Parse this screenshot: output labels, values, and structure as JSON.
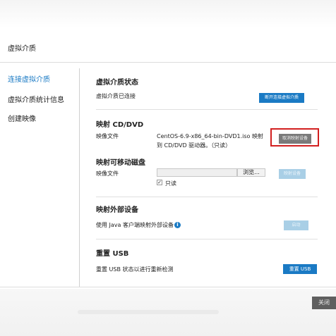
{
  "dialog": {
    "title": "虚拟介质"
  },
  "sidebar": {
    "items": [
      {
        "label": "连接虚拟介质"
      },
      {
        "label": "虚拟介质统计信息"
      },
      {
        "label": "创建映像"
      }
    ]
  },
  "status": {
    "title": "虚拟介质状态",
    "text": "虚拟介质已连接",
    "button": "断开连接虚拟介质"
  },
  "cd": {
    "title": "映射 CD/DVD",
    "label": "映像文件",
    "mapped_line1": "CentOS-6.9-x86_64-bin-DVD1.iso 映射",
    "mapped_line2": "到 CD/DVD 驱动器。（只读）",
    "button": "取消映射设备"
  },
  "removable": {
    "title": "映射可移动磁盘",
    "label": "映像文件",
    "file_value": "",
    "browse": "浏览...",
    "readonly_label": "只读",
    "readonly_checked": true,
    "button": "映射设备"
  },
  "external": {
    "title": "映射外部设备",
    "text": "使用 Java 客户端映射外部设备",
    "info_icon": "i",
    "button": "启动"
  },
  "usb": {
    "title": "重置 USB",
    "text": "重置 USB 状态以进行重新检测",
    "button": "重置 USB"
  },
  "footer": {
    "close": "关闭"
  },
  "colors": {
    "accent": "#1a7ac4",
    "highlight": "#d21f1f"
  }
}
